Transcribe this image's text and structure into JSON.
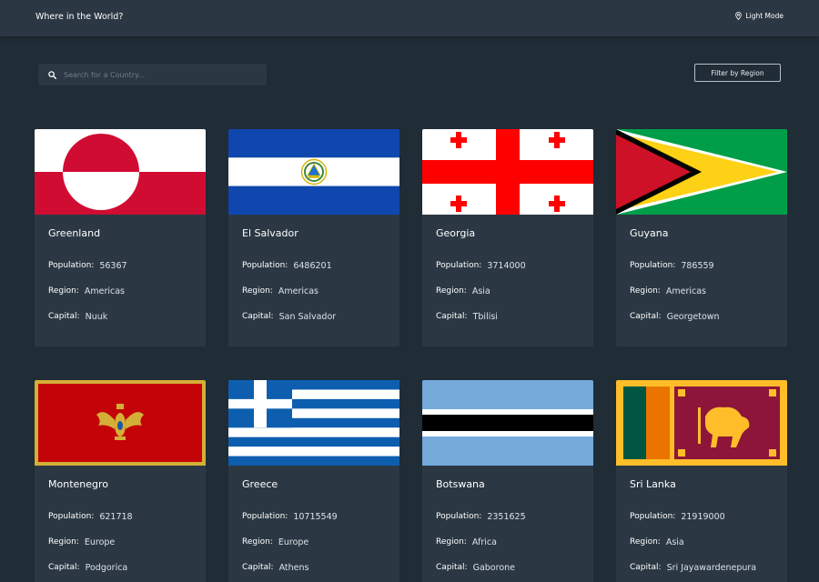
{
  "header": {
    "title": "Where in the World?",
    "mode_label": "Light Mode"
  },
  "search": {
    "placeholder": "Search for a Country...",
    "value": ""
  },
  "filter": {
    "label": "Filter by Region"
  },
  "labels": {
    "population": "Population:",
    "region": "Region:",
    "capital": "Capital:"
  },
  "countries": [
    {
      "name": "Greenland",
      "population": "56367",
      "region": "Americas",
      "capital": "Nuuk"
    },
    {
      "name": "El Salvador",
      "population": "6486201",
      "region": "Americas",
      "capital": "San Salvador"
    },
    {
      "name": "Georgia",
      "population": "3714000",
      "region": "Asia",
      "capital": "Tbilisi"
    },
    {
      "name": "Guyana",
      "population": "786559",
      "region": "Americas",
      "capital": "Georgetown"
    },
    {
      "name": "Montenegro",
      "population": "621718",
      "region": "Europe",
      "capital": "Podgorica"
    },
    {
      "name": "Greece",
      "population": "10715549",
      "region": "Europe",
      "capital": "Athens"
    },
    {
      "name": "Botswana",
      "population": "2351625",
      "region": "Africa",
      "capital": "Gaborone"
    },
    {
      "name": "Sri Lanka",
      "population": "21919000",
      "region": "Asia",
      "capital": "Sri Jayawardenepura"
    }
  ],
  "colors": {
    "background": "#202c36",
    "surface": "#2b3844",
    "text": "#ffffff"
  }
}
